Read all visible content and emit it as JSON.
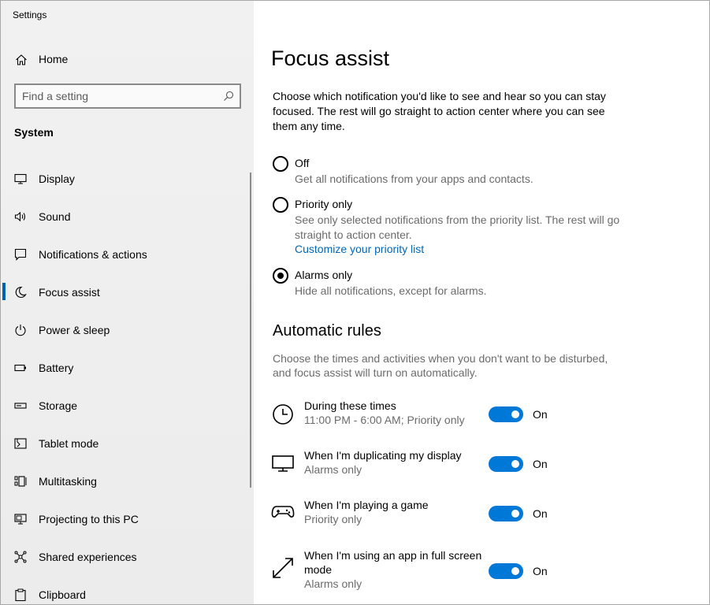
{
  "window": {
    "title": "Settings"
  },
  "sidebar": {
    "home_label": "Home",
    "search_placeholder": "Find a setting",
    "section": "System",
    "items": [
      {
        "label": "Display",
        "icon": "monitor-icon"
      },
      {
        "label": "Sound",
        "icon": "speaker-icon"
      },
      {
        "label": "Notifications & actions",
        "icon": "notifications-icon"
      },
      {
        "label": "Focus assist",
        "icon": "moon-icon",
        "active": true
      },
      {
        "label": "Power & sleep",
        "icon": "power-icon"
      },
      {
        "label": "Battery",
        "icon": "battery-icon"
      },
      {
        "label": "Storage",
        "icon": "storage-icon"
      },
      {
        "label": "Tablet mode",
        "icon": "tablet-icon"
      },
      {
        "label": "Multitasking",
        "icon": "multitasking-icon"
      },
      {
        "label": "Projecting to this PC",
        "icon": "projecting-icon"
      },
      {
        "label": "Shared experiences",
        "icon": "shared-icon"
      },
      {
        "label": "Clipboard",
        "icon": "clipboard-icon"
      }
    ]
  },
  "main": {
    "title": "Focus assist",
    "intro": "Choose which notification you'd like to see and hear so you can stay focused. The rest will go straight to action center where you can see them any time.",
    "options": [
      {
        "label": "Off",
        "desc": "Get all notifications from your apps and contacts.",
        "checked": false
      },
      {
        "label": "Priority only",
        "desc": "See only selected notifications from the priority list. The rest will go straight to action center.",
        "link": "Customize your priority list",
        "checked": false
      },
      {
        "label": "Alarms only",
        "desc": "Hide all notifications, except for alarms.",
        "checked": true
      }
    ],
    "rules_title": "Automatic rules",
    "rules_desc": "Choose the times and activities when you don't want to be disturbed, and focus assist will turn on automatically.",
    "rules": [
      {
        "name": "During these times",
        "sub": "11:00 PM - 6:00 AM; Priority only",
        "state": "On",
        "icon": "clock-icon"
      },
      {
        "name": "When I'm duplicating my display",
        "sub": "Alarms only",
        "state": "On",
        "icon": "display-icon"
      },
      {
        "name": "When I'm playing a game",
        "sub": "Priority only",
        "state": "On",
        "icon": "gamepad-icon"
      },
      {
        "name": "When I'm using an app in full screen mode",
        "sub": "Alarms only",
        "state": "On",
        "icon": "fullscreen-icon"
      }
    ]
  },
  "colors": {
    "accent": "#0078d7",
    "link": "#0067b8",
    "secondary_text": "#6b6b6b"
  }
}
